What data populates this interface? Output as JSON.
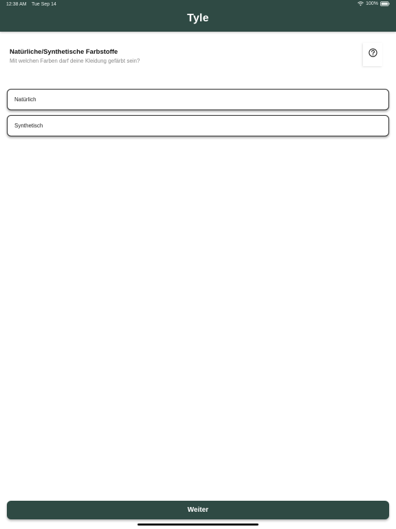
{
  "status_bar": {
    "time": "12:38 AM",
    "date": "Tue Sep 14",
    "battery": "100%"
  },
  "header": {
    "title": "Tyle"
  },
  "question": {
    "title": "Natürliche/Synthetische Farbstoffe",
    "subtitle": "Mit welchen Farben darf deine Kleidung gefärbt sein?"
  },
  "help": {
    "icon": "question-circle-icon"
  },
  "options": [
    {
      "label": "Natürlich"
    },
    {
      "label": "Synthetisch"
    }
  ],
  "footer": {
    "next_label": "Weiter"
  },
  "colors": {
    "brand": "#2f4a44"
  }
}
